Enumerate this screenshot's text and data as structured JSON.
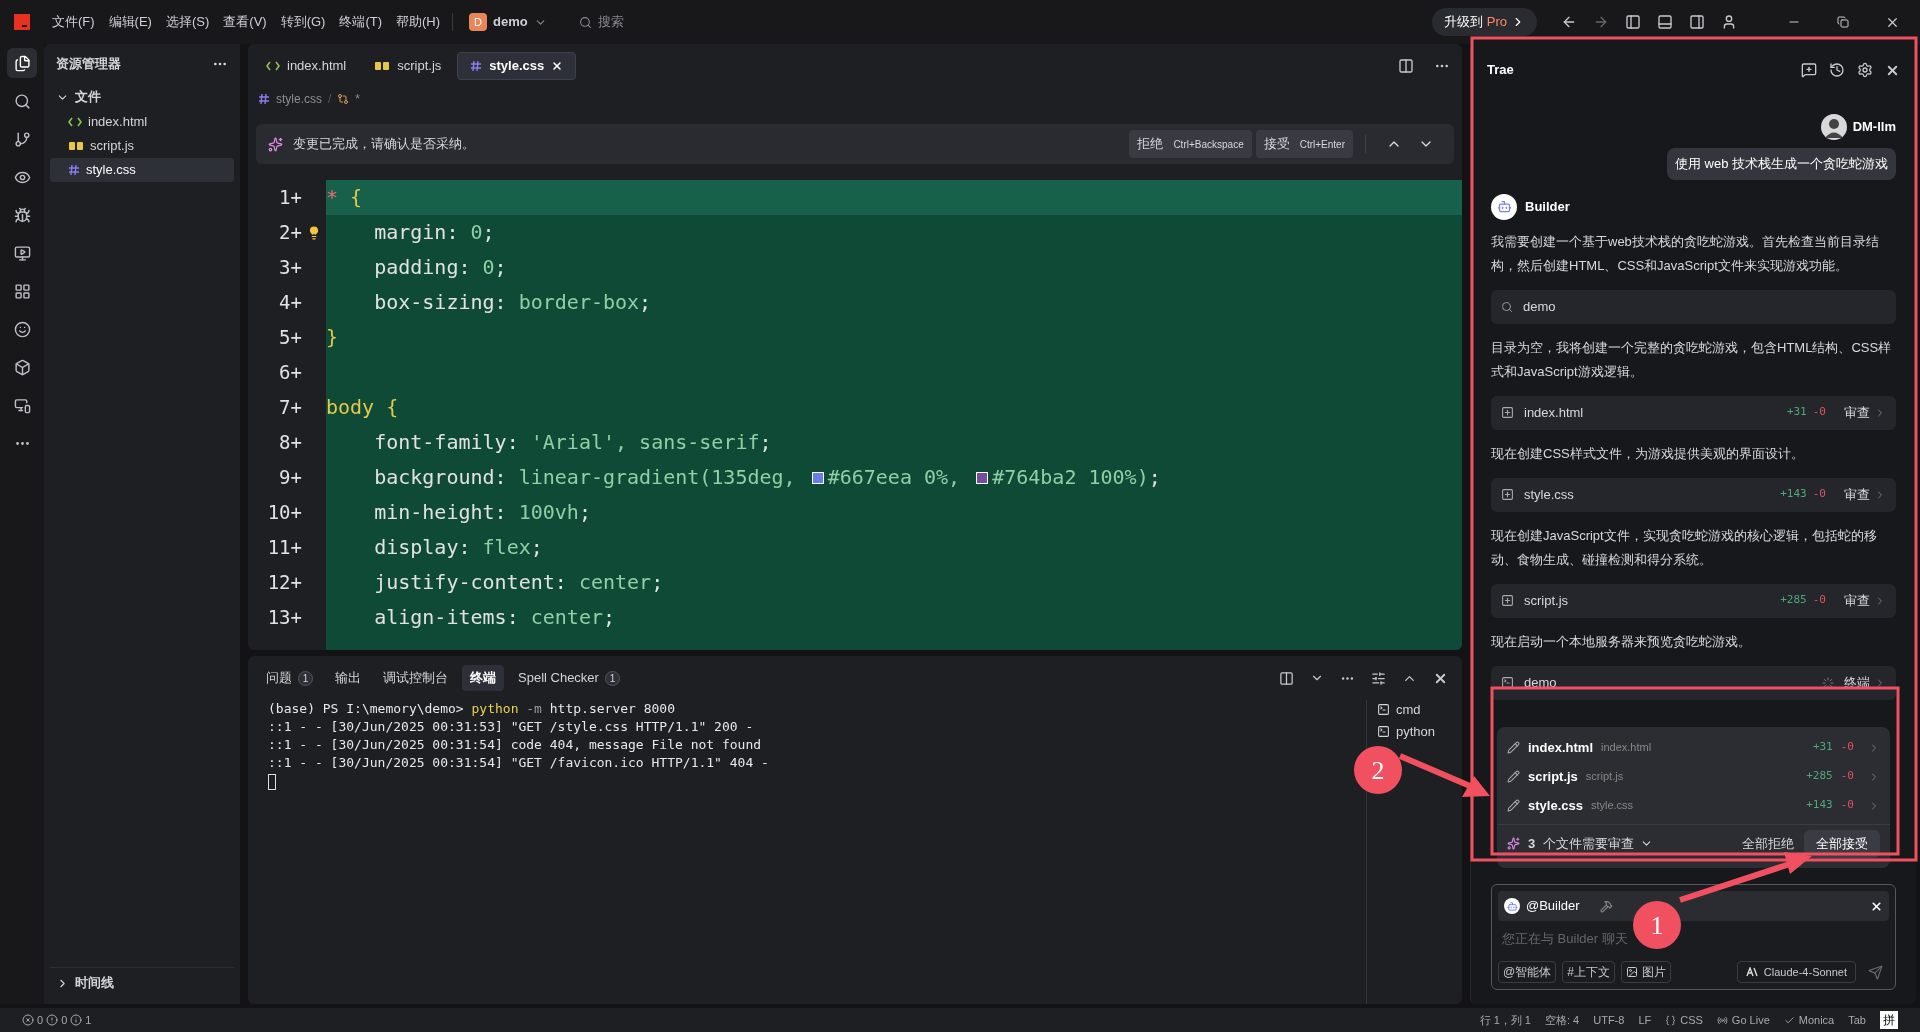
{
  "title_bar": {
    "menus": [
      "文件(F)",
      "编辑(E)",
      "选择(S)",
      "查看(V)",
      "转到(G)",
      "终端(T)",
      "帮助(H)"
    ],
    "project": {
      "initial": "D",
      "name": "demo"
    },
    "search": {
      "placeholder": "搜索"
    },
    "upgrade": {
      "label": "升级到",
      "accent": "Pro"
    }
  },
  "activity_bar": [
    {
      "kind": "files",
      "selected": true
    },
    {
      "kind": "search",
      "selected": false
    },
    {
      "kind": "git",
      "selected": false
    },
    {
      "kind": "eye",
      "selected": false
    },
    {
      "kind": "bug",
      "selected": false
    },
    {
      "kind": "monitor",
      "selected": false
    },
    {
      "kind": "grid",
      "selected": false
    },
    {
      "kind": "smile",
      "selected": false
    },
    {
      "kind": "box",
      "selected": false
    },
    {
      "kind": "remote",
      "selected": false
    },
    {
      "kind": "more",
      "selected": false
    }
  ],
  "explorer": {
    "title": "资源管理器",
    "section": {
      "label": "文件",
      "expanded": true
    },
    "files": [
      {
        "name": "index.html",
        "kind": "html",
        "selected": false
      },
      {
        "name": "script.js",
        "kind": "js",
        "selected": false
      },
      {
        "name": "style.css",
        "kind": "css",
        "selected": true
      }
    ],
    "timeline": {
      "label": "时间线",
      "expanded": false
    }
  },
  "editor": {
    "tabs": [
      {
        "name": "index.html",
        "kind": "html",
        "selected": false
      },
      {
        "name": "script.js",
        "kind": "js",
        "selected": false
      },
      {
        "name": "style.css",
        "kind": "css",
        "selected": true
      }
    ],
    "breadcrumb": {
      "file": "style.css",
      "separator": "/",
      "mark": "*"
    },
    "banner": {
      "message": "变更已完成，请确认是否采纳。",
      "reject": {
        "label": "拒绝",
        "shortcut": "Ctrl+Backspace"
      },
      "accept": {
        "label": "接受",
        "shortcut": "Ctrl+Enter"
      }
    },
    "lines": [
      {
        "number": "1+",
        "current": true,
        "hint": false,
        "tokens": [
          {
            "text": "* ",
            "kind": "universal"
          },
          {
            "text": "{",
            "kind": "brace"
          }
        ]
      },
      {
        "number": "2+",
        "current": false,
        "hint": true,
        "tokens": [
          {
            "text": "    margin",
            "kind": "prop"
          },
          {
            "text": ": ",
            "kind": "punct"
          },
          {
            "text": "0",
            "kind": "val"
          },
          {
            "text": ";",
            "kind": "punct"
          }
        ]
      },
      {
        "number": "3+",
        "current": false,
        "hint": false,
        "tokens": [
          {
            "text": "    padding",
            "kind": "prop"
          },
          {
            "text": ": ",
            "kind": "punct"
          },
          {
            "text": "0",
            "kind": "val"
          },
          {
            "text": ";",
            "kind": "punct"
          }
        ]
      },
      {
        "number": "4+",
        "current": false,
        "hint": false,
        "tokens": [
          {
            "text": "    box-sizing",
            "kind": "prop"
          },
          {
            "text": ": ",
            "kind": "punct"
          },
          {
            "text": "border-box",
            "kind": "val"
          },
          {
            "text": ";",
            "kind": "punct"
          }
        ]
      },
      {
        "number": "5+",
        "current": false,
        "hint": false,
        "tokens": [
          {
            "text": "}",
            "kind": "brace"
          }
        ]
      },
      {
        "number": "6+"
      },
      {
        "number": "7+",
        "current": false,
        "hint": false,
        "tokens": [
          {
            "text": "body ",
            "kind": "tag"
          },
          {
            "text": "{",
            "kind": "brace"
          }
        ]
      },
      {
        "number": "8+",
        "current": false,
        "hint": false,
        "tokens": [
          {
            "text": "    font-family",
            "kind": "prop"
          },
          {
            "text": ": ",
            "kind": "punct"
          },
          {
            "text": "'Arial', sans-serif",
            "kind": "val"
          },
          {
            "text": ";",
            "kind": "punct"
          }
        ]
      },
      {
        "number": "9+",
        "current": false,
        "hint": false,
        "tokens": [
          {
            "text": "    background",
            "kind": "prop"
          },
          {
            "text": ": ",
            "kind": "punct"
          },
          {
            "text": "linear-gradient(135deg, ",
            "kind": "val"
          },
          {
            "kind": "swatch",
            "color": "#667eea"
          },
          {
            "text": "#667eea 0%, ",
            "kind": "val"
          },
          {
            "kind": "swatch",
            "color": "#764ba2"
          },
          {
            "text": "#764ba2 100%)",
            "kind": "val"
          },
          {
            "text": ";",
            "kind": "punct"
          }
        ]
      },
      {
        "number": "10+",
        "current": false,
        "hint": false,
        "tokens": [
          {
            "text": "    min-height",
            "kind": "prop"
          },
          {
            "text": ": ",
            "kind": "punct"
          },
          {
            "text": "100vh",
            "kind": "val"
          },
          {
            "text": ";",
            "kind": "punct"
          }
        ]
      },
      {
        "number": "11+",
        "current": false,
        "hint": false,
        "tokens": [
          {
            "text": "    display",
            "kind": "prop"
          },
          {
            "text": ": ",
            "kind": "punct"
          },
          {
            "text": "flex",
            "kind": "val"
          },
          {
            "text": ";",
            "kind": "punct"
          }
        ]
      },
      {
        "number": "12+",
        "current": false,
        "hint": false,
        "tokens": [
          {
            "text": "    justify-content",
            "kind": "prop"
          },
          {
            "text": ": ",
            "kind": "punct"
          },
          {
            "text": "center",
            "kind": "val"
          },
          {
            "text": ";",
            "kind": "punct"
          }
        ]
      },
      {
        "number": "13+",
        "current": false,
        "hint": false,
        "tokens": [
          {
            "text": "    align-items",
            "kind": "prop"
          },
          {
            "text": ": ",
            "kind": "punct"
          },
          {
            "text": "center",
            "kind": "val"
          },
          {
            "text": ";",
            "kind": "punct"
          }
        ]
      }
    ]
  },
  "panel": {
    "tabs": [
      {
        "label": "问题",
        "count": "1",
        "selected": false
      },
      {
        "label": "输出",
        "selected": false
      },
      {
        "label": "调试控制台",
        "selected": false
      },
      {
        "label": "终端",
        "selected": true
      },
      {
        "label": "Spell Checker",
        "count": "1",
        "selected": false
      }
    ],
    "terminal": [
      [
        {
          "text": "(base) PS I:\\memory\\demo> ",
          "kind": "plain"
        },
        {
          "text": "python",
          "kind": "cmd"
        },
        {
          "text": " -m",
          "kind": "flag"
        },
        {
          "text": " http.server 8000",
          "kind": "plain"
        }
      ],
      [
        {
          "text": "::1 - - [30/Jun/2025 00:31:53] \"GET /style.css HTTP/1.1\" 200 -",
          "kind": "plain"
        }
      ],
      [
        {
          "text": "::1 - - [30/Jun/2025 00:31:54] code 404, message File not found",
          "kind": "plain"
        }
      ],
      [
        {
          "text": "::1 - - [30/Jun/2025 00:31:54] \"GET /favicon.ico HTTP/1.1\" 404 -",
          "kind": "plain"
        }
      ]
    ],
    "sessions": [
      "cmd",
      "python"
    ]
  },
  "assistant": {
    "title": "Trae",
    "user": {
      "name": "DM-llm",
      "message": "使用 web 技术栈生成一个贪吃蛇游戏"
    },
    "bot": "Builder",
    "messages": [
      {
        "kind": "text",
        "text": "我需要创建一个基于web技术栈的贪吃蛇游戏。首先检查当前目录结构，然后创建HTML、CSS和JavaScript文件来实现游戏功能。"
      },
      {
        "kind": "search",
        "text": "demo"
      },
      {
        "kind": "text",
        "text": "目录为空，我将创建一个完整的贪吃蛇游戏，包含HTML结构、CSS样式和JavaScript游戏逻辑。"
      },
      {
        "kind": "file",
        "text": "index.html",
        "added": "+31",
        "removed": "-0",
        "action": "审查"
      },
      {
        "kind": "text",
        "text": "现在创建CSS样式文件，为游戏提供美观的界面设计。"
      },
      {
        "kind": "file",
        "text": "style.css",
        "added": "+143",
        "removed": "-0",
        "action": "审查"
      },
      {
        "kind": "text",
        "text": "现在创建JavaScript文件，实现贪吃蛇游戏的核心逻辑，包括蛇的移动、食物生成、碰撞检测和得分系统。"
      },
      {
        "kind": "file",
        "text": "script.js",
        "added": "+285",
        "removed": "-0",
        "action": "审查"
      },
      {
        "kind": "text",
        "text": "现在启动一个本地服务器来预览贪吃蛇游戏。"
      },
      {
        "kind": "terminal",
        "text": "demo",
        "action": "终端"
      }
    ],
    "review": {
      "files": [
        {
          "name": "index.html",
          "path": "index.html",
          "added": "+31",
          "removed": "-0"
        },
        {
          "name": "script.js",
          "path": "script.js",
          "added": "+285",
          "removed": "-0"
        },
        {
          "name": "style.css",
          "path": "style.css",
          "added": "+143",
          "removed": "-0"
        }
      ],
      "count": "3",
      "label": "个文件需要审查",
      "reject_all": "全部拒绝",
      "accept_all": "全部接受"
    },
    "input": {
      "agent": "@Builder",
      "placeholder": "您正在与 Builder 聊天",
      "buttons": [
        {
          "kind": "agent",
          "label": "@智能体"
        },
        {
          "kind": "context",
          "label": "#上下文"
        },
        {
          "kind": "image",
          "label": "图片"
        }
      ],
      "model": "Claude-4-Sonnet"
    }
  },
  "status_bar": {
    "errors": "0",
    "warnings": "0",
    "infos": "1",
    "items": [
      {
        "kind": "position",
        "label": "行 1，列 1"
      },
      {
        "kind": "plain",
        "label": "空格: 4"
      },
      {
        "kind": "plain",
        "label": "UTF-8"
      },
      {
        "kind": "plain",
        "label": "LF"
      },
      {
        "kind": "language",
        "label": "CSS"
      },
      {
        "kind": "live",
        "label": "Go Live"
      },
      {
        "kind": "check",
        "label": "Monica"
      },
      {
        "kind": "plain",
        "label": "Tab"
      }
    ],
    "ime": "拼"
  },
  "annotations": [
    "1",
    "2"
  ]
}
